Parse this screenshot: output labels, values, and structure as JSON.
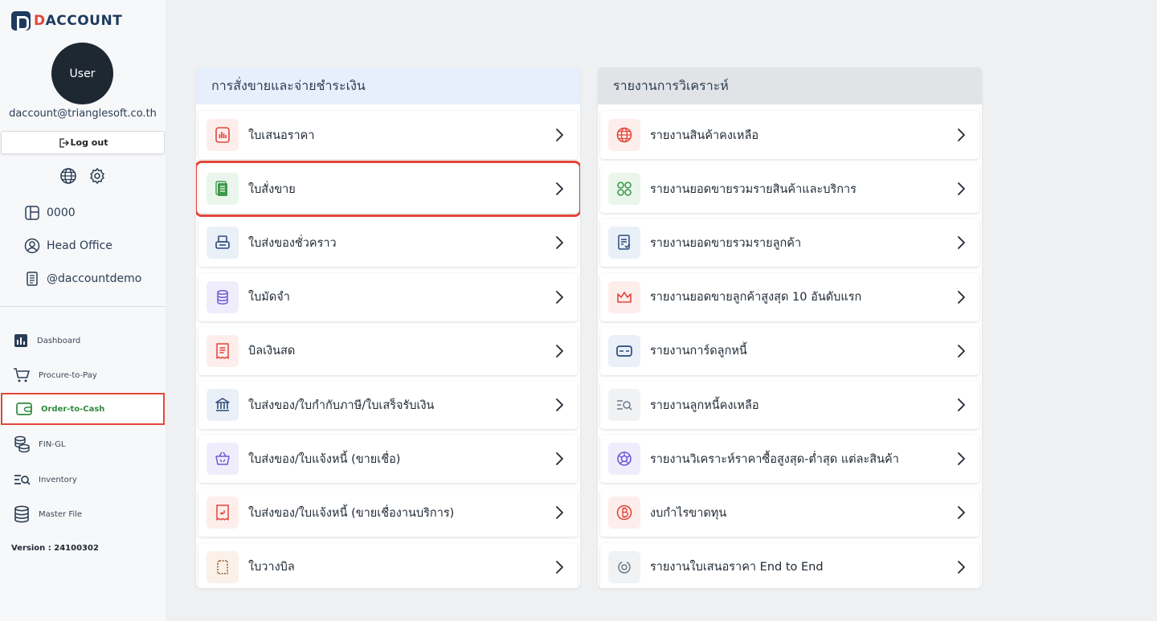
{
  "brand": {
    "logo_letter": "D",
    "name_prefix": "D",
    "name_rest": "ACCOUNT"
  },
  "user": {
    "avatar_label": "User",
    "email": "daccount@trianglesoft.co.th",
    "logout_label": "Log out"
  },
  "info": {
    "branch_code": "0000",
    "branch_name": "Head Office",
    "company": "@daccountdemo"
  },
  "nav": {
    "items": [
      {
        "label": "Dashboard",
        "icon": "chart-icon"
      },
      {
        "label": "Procure-to-Pay",
        "icon": "cart-icon"
      },
      {
        "label": "Order-to-Cash",
        "icon": "wallet-icon",
        "active": true
      },
      {
        "label": "FIN-GL",
        "icon": "coins-icon"
      },
      {
        "label": "Inventory",
        "icon": "list-search-icon"
      },
      {
        "label": "Master File",
        "icon": "database-icon"
      }
    ],
    "version": "Version : 24100302"
  },
  "sales_panel": {
    "title": "การสั่งขายและจ่ายชำระเงิน",
    "items": [
      {
        "label": "ใบเสนอราคา",
        "icon": "bar-chart-doc-icon",
        "color": "#e2453a",
        "bg": "#fdeeec"
      },
      {
        "label": "ใบสั่งขาย",
        "icon": "document-list-icon",
        "color": "#3d9a4a",
        "bg": "#eaf6ec",
        "highlighted": true
      },
      {
        "label": "ใบส่งของชั่วคราว",
        "icon": "printer-icon",
        "color": "#2b4a7a",
        "bg": "#eaf0f8"
      },
      {
        "label": "ใบมัดจำ",
        "icon": "coin-stack-icon",
        "color": "#6b5bd6",
        "bg": "#efedfb"
      },
      {
        "label": "บิลเงินสด",
        "icon": "receipt-icon",
        "color": "#e2453a",
        "bg": "#fdeeec"
      },
      {
        "label": "ใบส่งของ/ใบกำกับภาษี/ใบเสร็จรับเงิน",
        "icon": "bank-icon",
        "color": "#2b4a7a",
        "bg": "#eaf0f8"
      },
      {
        "label": "ใบส่งของ/ใบแจ้งหนี้ (ขายเชื่อ)",
        "icon": "basket-icon",
        "color": "#6b5bd6",
        "bg": "#efedfb"
      },
      {
        "label": "ใบส่งของ/ใบแจ้งหนี้ (ขายเชื่องานบริการ)",
        "icon": "return-receipt-icon",
        "color": "#e2453a",
        "bg": "#fdeeec"
      },
      {
        "label": "ใบวางบิล",
        "icon": "card-outline-icon",
        "color": "#8a5a2b",
        "bg": "#fbf1e8"
      }
    ]
  },
  "report_panel": {
    "title": "รายงานการวิเคราะห์",
    "items": [
      {
        "label": "รายงานสินค้าคงเหลือ",
        "icon": "globe-icon",
        "color": "#e2453a",
        "bg": "#fdeeec"
      },
      {
        "label": "รายงานยอดขายรวมรายสินค้าและบริการ",
        "icon": "grid-circles-icon",
        "color": "#3d9a4a",
        "bg": "#eaf6ec"
      },
      {
        "label": "รายงานยอดขายรวมรายลูกค้า",
        "icon": "checklist-icon",
        "color": "#2b4a7a",
        "bg": "#eaf0f8"
      },
      {
        "label": "รายงานยอดขายลูกค้าสูงสุด 10 อันดับแรก",
        "icon": "crown-icon",
        "color": "#e2453a",
        "bg": "#fdeeec"
      },
      {
        "label": "รายงานการ์ดลูกหนี้",
        "icon": "credit-card-icon",
        "color": "#2b4a7a",
        "bg": "#eaf0f8"
      },
      {
        "label": "รายงานลูกหนี้คงเหลือ",
        "icon": "list-search-icon",
        "color": "#6a7a8c",
        "bg": "#f0f2f4"
      },
      {
        "label": "รายงานวิเคราะห์ราคาซื้อสูงสุด-ต่ำสุด แต่ละสินค้า",
        "icon": "pie-icon",
        "color": "#6b5bd6",
        "bg": "#efedfb"
      },
      {
        "label": "งบกำไรขาดทุน",
        "icon": "bitcoin-icon",
        "color": "#e2453a",
        "bg": "#fdeeec"
      },
      {
        "label": "รายงานใบเสนอราคา End to End",
        "icon": "spiral-icon",
        "color": "#6a7a8c",
        "bg": "#f0f2f4"
      }
    ]
  }
}
